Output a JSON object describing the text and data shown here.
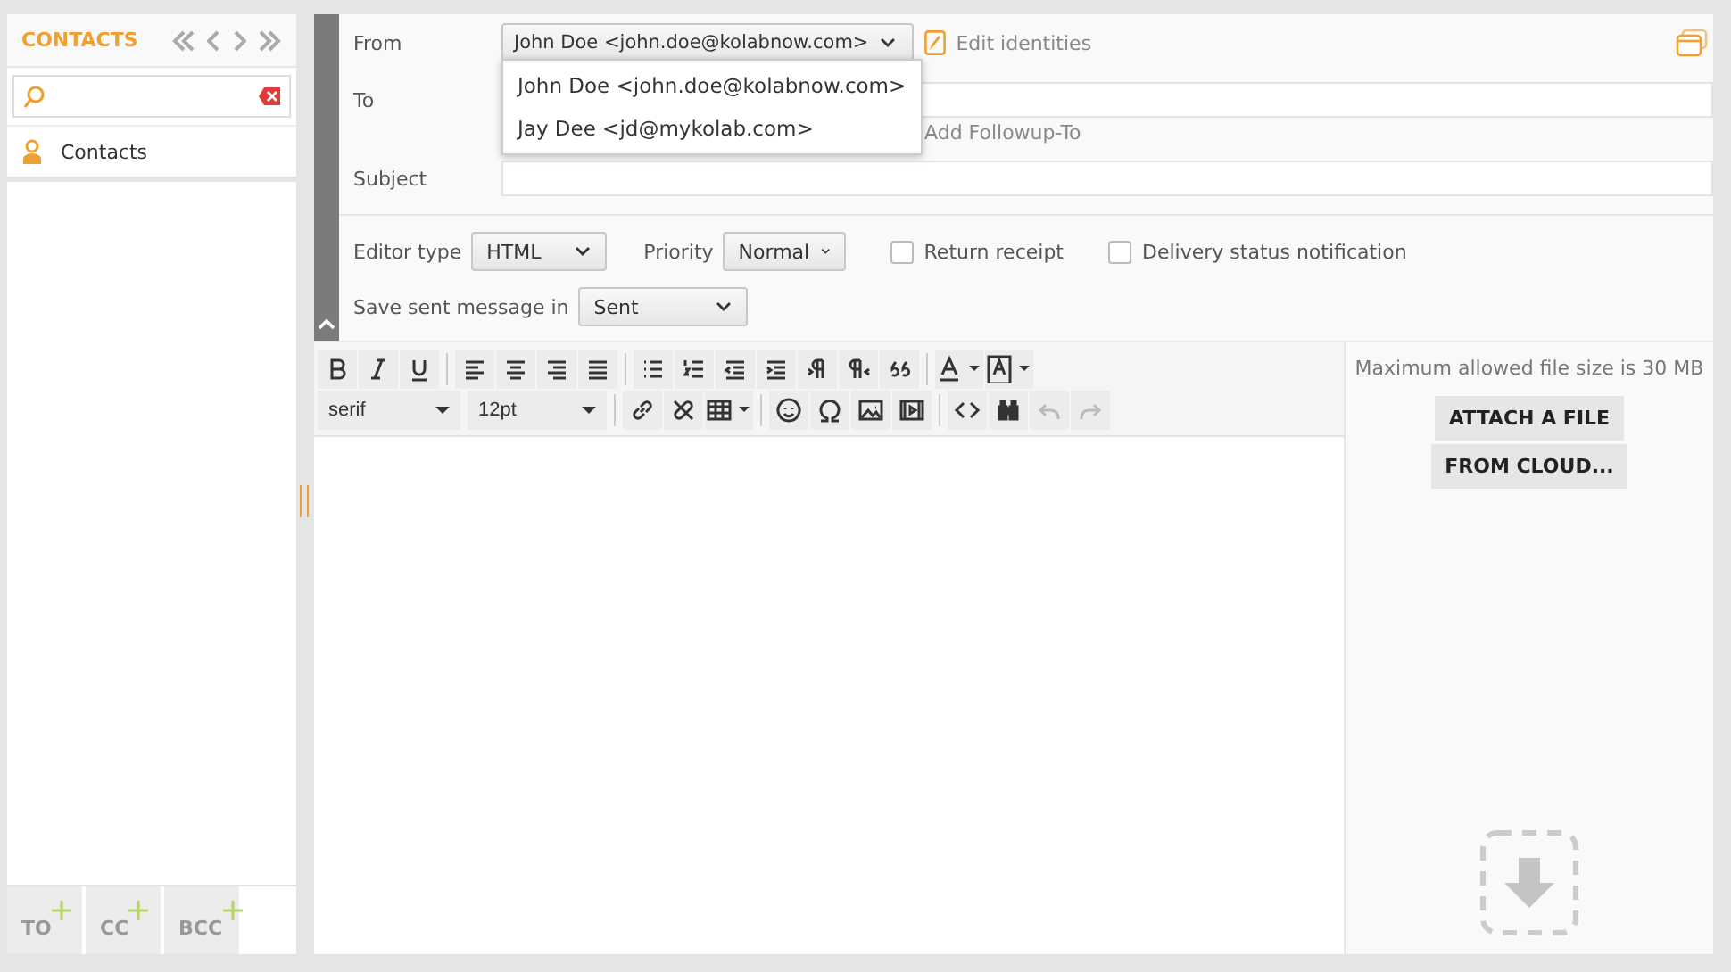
{
  "contacts": {
    "title": "CONTACTS",
    "items": [
      {
        "label": "Contacts"
      }
    ]
  },
  "recipient_buttons": [
    "TO",
    "CC",
    "BCC"
  ],
  "compose": {
    "from": {
      "label": "From",
      "value": "John Doe <john.doe@kolabnow.com>",
      "expanded": true,
      "options": [
        "John Doe <john.doe@kolabnow.com>",
        "Jay Dee <jd@mykolab.com>"
      ]
    },
    "edit_identities": "Edit identities",
    "to": {
      "label": "To"
    },
    "add_links": [
      "Add Followup-To"
    ],
    "subject": {
      "label": "Subject"
    },
    "editor_type": {
      "label": "Editor type",
      "value": "HTML"
    },
    "priority": {
      "label": "Priority",
      "value": "Normal"
    },
    "checkboxes": [
      {
        "label": "Return receipt",
        "checked": false
      },
      {
        "label": "Delivery status notification",
        "checked": false
      }
    ],
    "save_sent": {
      "label": "Save sent message in",
      "value": "Sent"
    }
  },
  "editor": {
    "font": "serif",
    "size": "12pt"
  },
  "attachments": {
    "note": "Maximum allowed file size is 30 MB",
    "buttons": [
      "ATTACH A FILE",
      "FROM CLOUD..."
    ]
  }
}
